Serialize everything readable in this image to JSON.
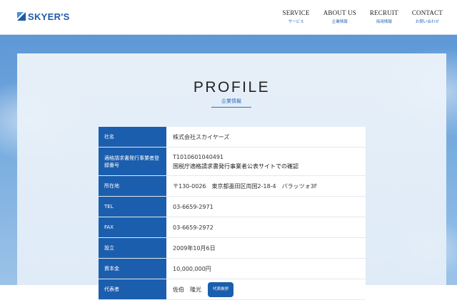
{
  "header": {
    "logo_text": "SKYER'S",
    "nav": [
      {
        "label": "SERVICE",
        "sub": "サービス"
      },
      {
        "label": "ABOUT US",
        "sub": "企業情報"
      },
      {
        "label": "RECRUIT",
        "sub": "採用情報"
      },
      {
        "label": "CONTACT",
        "sub": "お問い合わせ"
      }
    ]
  },
  "page": {
    "title": "PROFILE",
    "subtitle": "企業情報"
  },
  "profile": [
    {
      "label": "社名",
      "value": "株式会社スカイヤーズ"
    },
    {
      "label": "適格請求書発行事業者登録番号",
      "value": "T1010601040491",
      "value2": "国税庁適格請求書発行事業者公表サイトでの確認"
    },
    {
      "label": "所在地",
      "value": "〒130-0026　東京都墨田区両国2-18-4　パラッツォ3F"
    },
    {
      "label": "TEL",
      "value": "03-6659-2971"
    },
    {
      "label": "FAX",
      "value": "03-6659-2972"
    },
    {
      "label": "設立",
      "value": "2009年10月6日"
    },
    {
      "label": "資本金",
      "value": "10,000,000円"
    },
    {
      "label": "代表者",
      "value": "佐伯　隆光",
      "button": "代表挨拶"
    }
  ],
  "colors": {
    "primary": "#1b5eae",
    "accent": "#2a67b8"
  }
}
